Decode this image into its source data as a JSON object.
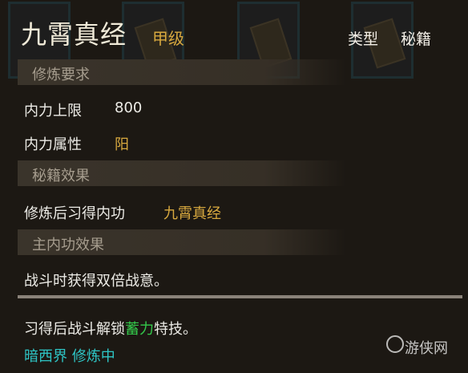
{
  "item": {
    "name": "九霄真经",
    "grade": "甲级",
    "type_label": "类型",
    "type_value": "秘籍"
  },
  "requirements": {
    "header": "修炼要求",
    "neili_limit_label": "内力上限",
    "neili_limit_value": "800",
    "neili_attr_label": "内力属性",
    "neili_attr_value": "阳"
  },
  "effects": {
    "header": "秘籍效果",
    "learn_label": "修炼后习得内功",
    "learn_value": "九霄真经"
  },
  "main_effect": {
    "header": "主内功效果",
    "text": "战斗时获得双倍战意。"
  },
  "unlock": {
    "prefix": "习得后战斗解锁",
    "highlight": "蓄力",
    "suffix": "特技。"
  },
  "status": {
    "location": "暗西界",
    "state": "修炼中"
  },
  "watermark": "游侠网",
  "colors": {
    "gold": "#d8a93f",
    "green": "#33c84a",
    "cyan": "#2ec5c5",
    "header_text": "#a69d8e"
  }
}
